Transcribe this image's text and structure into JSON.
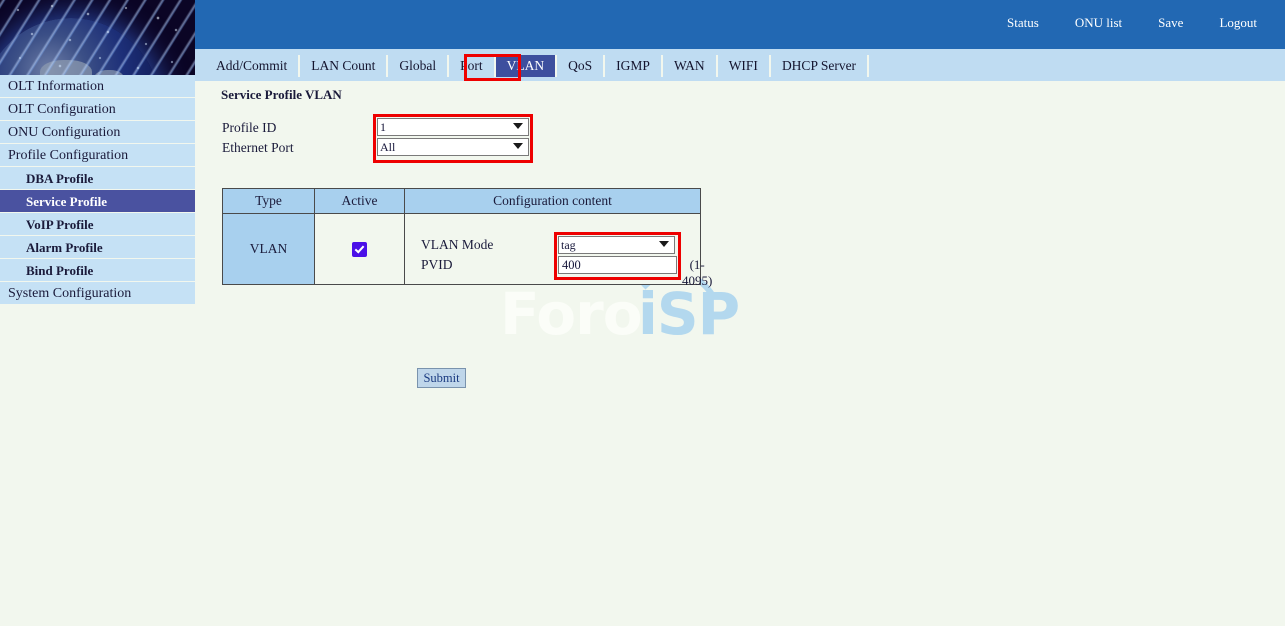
{
  "header": {
    "links": [
      {
        "label": "Status"
      },
      {
        "label": "ONU list"
      },
      {
        "label": "Save"
      },
      {
        "label": "Logout"
      }
    ]
  },
  "sidebar": {
    "items": [
      {
        "label": "OLT Information",
        "sub": false,
        "active": false
      },
      {
        "label": "OLT Configuration",
        "sub": false,
        "active": false
      },
      {
        "label": "ONU Configuration",
        "sub": false,
        "active": false
      },
      {
        "label": "Profile Configuration",
        "sub": false,
        "active": false
      },
      {
        "label": "DBA Profile",
        "sub": true,
        "active": false
      },
      {
        "label": "Service Profile",
        "sub": true,
        "active": true
      },
      {
        "label": "VoIP Profile",
        "sub": true,
        "active": false
      },
      {
        "label": "Alarm Profile",
        "sub": true,
        "active": false
      },
      {
        "label": "Bind Profile",
        "sub": true,
        "active": false
      },
      {
        "label": "System Configuration",
        "sub": false,
        "active": false
      }
    ]
  },
  "tabs": [
    {
      "label": "Add/Commit",
      "selected": false
    },
    {
      "label": "LAN Count",
      "selected": false
    },
    {
      "label": "Global",
      "selected": false
    },
    {
      "label": "Port",
      "selected": false
    },
    {
      "label": "VLAN",
      "selected": true
    },
    {
      "label": "QoS",
      "selected": false
    },
    {
      "label": "IGMP",
      "selected": false
    },
    {
      "label": "WAN",
      "selected": false
    },
    {
      "label": "WIFI",
      "selected": false
    },
    {
      "label": "DHCP Server",
      "selected": false
    }
  ],
  "main": {
    "page_title": "Service Profile VLAN",
    "form": {
      "profile_id_label": "Profile ID",
      "profile_id_value": "1",
      "profile_id_options": [
        "1"
      ],
      "ethernet_port_label": "Ethernet Port",
      "ethernet_port_value": "All",
      "ethernet_port_options": [
        "All"
      ]
    },
    "table": {
      "headers": {
        "type": "Type",
        "active": "Active",
        "config": "Configuration content"
      },
      "row": {
        "type": "VLAN",
        "active_checked": true,
        "vlan_mode_label": "VLAN Mode",
        "vlan_mode_value": "tag",
        "vlan_mode_options": [
          "tag"
        ],
        "pvid_label": "PVID",
        "pvid_value": "400",
        "pvid_range": "(1-4095)"
      }
    },
    "submit_label": "Submit"
  },
  "watermark": {
    "text_light": "Foro",
    "text_blue": "iSP"
  },
  "colors": {
    "header_blue": "#2268b3",
    "tabbar_blue": "#bfdcf2",
    "tab_selected": "#3d4f9e",
    "sidebar_item": "#c5e1f5",
    "sidebar_active": "#4a52a0",
    "table_header": "#a8d0ee",
    "page_bg": "#f2f7ee",
    "annotation_red": "#ee0000",
    "checkbox_blue": "#4b10e8"
  }
}
